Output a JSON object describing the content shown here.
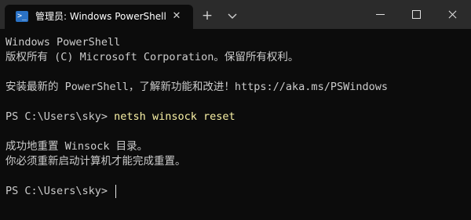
{
  "window": {
    "tab_title": "管理员: Windows PowerShell",
    "tab_icon_glyph": ">_"
  },
  "terminal": {
    "lines": [
      "Windows PowerShell",
      "版权所有 (C)  Microsoft Corporation。保留所有权利。",
      "",
      "安装最新的 PowerShell，了解新功能和改进！https://aka.ms/PSWindows",
      "",
      "",
      "",
      "成功地重置 Winsock 目录。",
      "你必须重新启动计算机才能完成重置。",
      "",
      ""
    ],
    "prompt_1": "PS C:\\Users\\sky> ",
    "command_1": "netsh winsock reset",
    "prompt_2": "PS C:\\Users\\sky> "
  },
  "colors": {
    "background": "#0c0c0c",
    "titlebar": "#2b2b2b",
    "text": "#cccccc",
    "command": "#f9f1a5",
    "accent": "#2a72c5"
  },
  "icons": {
    "tab": "powershell-icon",
    "close_tab": "close-icon",
    "new_tab": "plus-icon",
    "dropdown": "chevron-down-icon",
    "minimize": "minimize-icon",
    "maximize": "maximize-icon",
    "close_window": "close-icon"
  }
}
